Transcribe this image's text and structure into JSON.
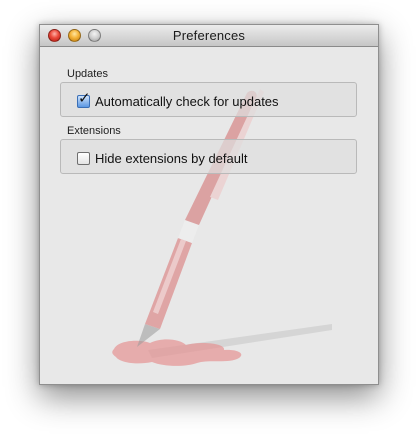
{
  "window": {
    "title": "Preferences",
    "traffic_lights": [
      "close",
      "minimize",
      "zoom"
    ]
  },
  "updates": {
    "label": "Updates",
    "auto_check": {
      "label": "Automatically check for updates",
      "checked": true
    }
  },
  "extensions": {
    "label": "Extensions",
    "hide_by_default": {
      "label": "Hide extensions by default",
      "checked": false
    }
  },
  "artwork": {
    "icon": "pen-ink-illustration",
    "color": "#d98080"
  }
}
